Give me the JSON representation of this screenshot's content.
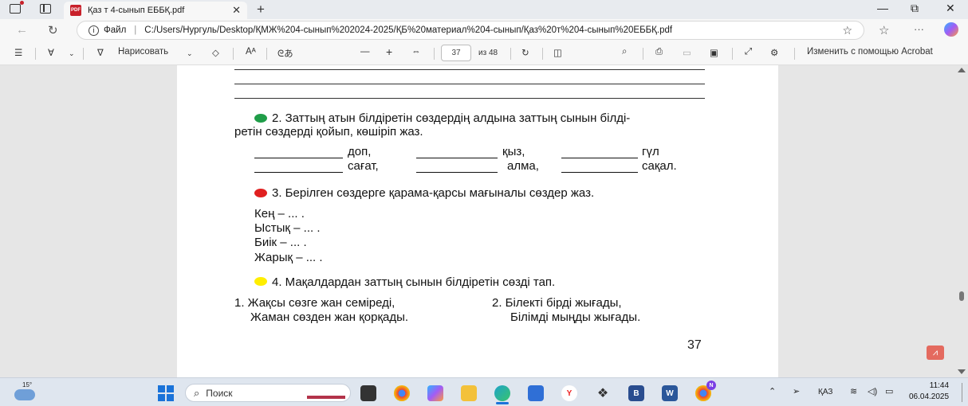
{
  "browser": {
    "tab_title": "Қаз т 4-сынып ЕББҚ.pdf",
    "tab_close": "✕",
    "new_tab": "+",
    "win_minimize": "—",
    "win_restore": "⧉",
    "win_close": "✕",
    "address_label": "Файл",
    "address_url": "C:/Users/Нургуль/Desktop/ҚМЖ%204-сынып%202024-2025/ҚБ%20материал%204-сынып/Қаз%20т%204-сынып%20ЕББҚ.pdf",
    "more": "···"
  },
  "pdf_toolbar": {
    "draw_label": "Нарисовать",
    "read_aloud": "Aᴬ",
    "translate": "ᘓあ",
    "zoom_out": "—",
    "zoom_in": "+",
    "page_current": "37",
    "page_total": "из 48",
    "acrobat_label": "Изменить с помощью Acrobat"
  },
  "document": {
    "task2": "2. Заттың атын білдіретін сөздердің алдына заттың сынын білді-",
    "task2_cont": "ретін сөздерді қойып, көшіріп жаз.",
    "words_row1": [
      "доп,",
      "қыз,",
      "гүл"
    ],
    "words_row2": [
      "сағат,",
      "алма,",
      "сақал."
    ],
    "task3": "3. Берілген сөздерге қарама-қарсы мағыналы сөздер жаз.",
    "pairs": [
      "Кең – ... .",
      "Ыстық – ... .",
      "Биік – ... .",
      "Жарық – ... ."
    ],
    "task4": "4. Мақалдардан заттың сынын білдіретін сөзді тап.",
    "prov1_line1": "1. Жақсы сөзге жан семіреді,",
    "prov1_line2": "Жаман сөзден жан қорқады.",
    "prov2_line1": "2. Білекті бірді жығады,",
    "prov2_line2": "Білімді мыңды жығады.",
    "page_number": "37",
    "dot_colors": {
      "green": "#1f9d48",
      "red": "#e02020",
      "yellow": "#ffee00"
    }
  },
  "taskbar": {
    "temperature": "15°",
    "search_label": "Поиск",
    "language": "ҚАЗ",
    "time": "11:44",
    "date": "06.04.2025",
    "chrome_badge": "N"
  }
}
